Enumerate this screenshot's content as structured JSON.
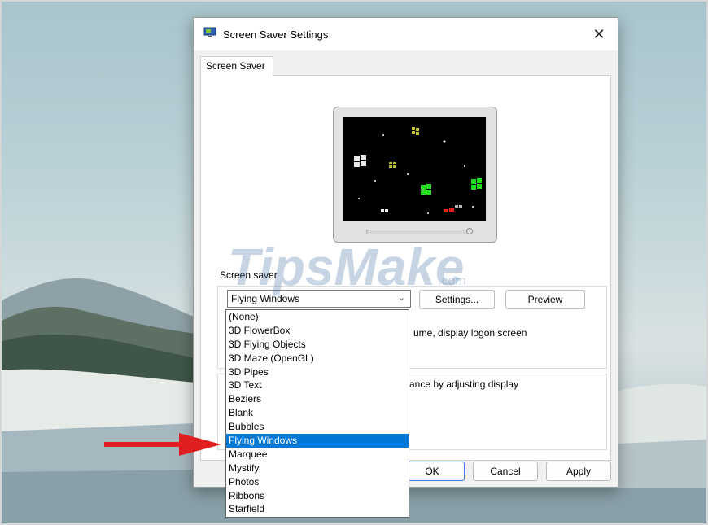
{
  "dialog": {
    "title": "Screen Saver Settings",
    "close_glyph": "✕",
    "tab_label": "Screen Saver"
  },
  "screen_saver": {
    "group_label": "Screen saver",
    "selected": "Flying Windows",
    "settings_label": "Settings...",
    "preview_label": "Preview",
    "resume_text_fragment": "ume, display logon screen",
    "power_text_fragment": "ance by adjusting display"
  },
  "dropdown": {
    "options": [
      "(None)",
      "3D FlowerBox",
      "3D Flying Objects",
      "3D Maze (OpenGL)",
      "3D Pipes",
      "3D Text",
      "Beziers",
      "Blank",
      "Bubbles",
      "Flying Windows",
      "Marquee",
      "Mystify",
      "Photos",
      "Ribbons",
      "Starfield"
    ],
    "highlighted": "Flying Windows"
  },
  "footer": {
    "ok_label": "OK",
    "cancel_label": "Cancel",
    "apply_label": "Apply"
  },
  "watermark": {
    "text": "TipsMake",
    "suffix": ".com"
  },
  "colors": {
    "selection": "#0078d7",
    "arrow": "#e02020",
    "window_green": "#22dd22",
    "window_red": "#e02020"
  },
  "icons": {
    "title_icon": "monitor-icon",
    "close": "close-icon",
    "combo_arrow": "chevron-down-icon",
    "annotation": "red-arrow-icon"
  }
}
